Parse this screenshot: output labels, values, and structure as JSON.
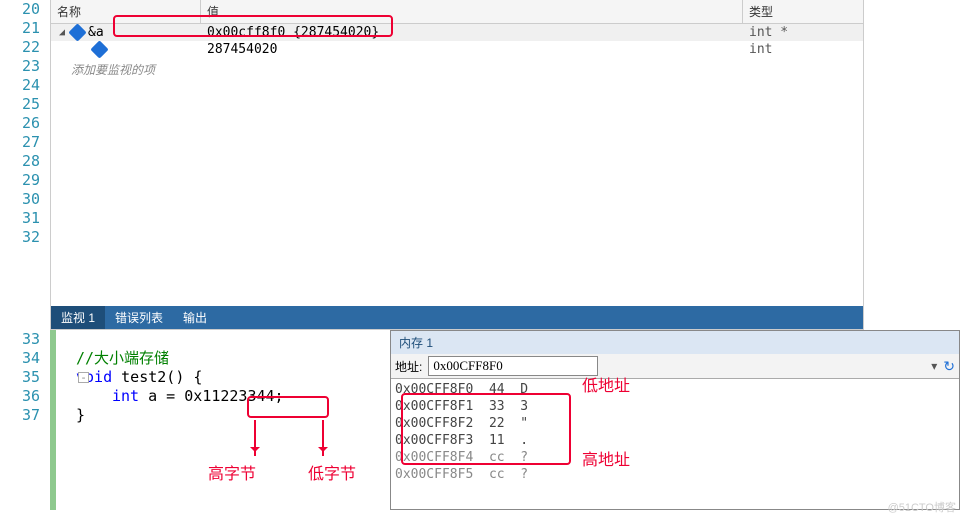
{
  "line_numbers": [
    "20",
    "21",
    "22",
    "23",
    "24",
    "25",
    "26",
    "27",
    "28",
    "29",
    "30",
    "31",
    "32",
    "33",
    "34",
    "35",
    "36",
    "37"
  ],
  "watch": {
    "headers": {
      "name": "名称",
      "value": "值",
      "type": "类型"
    },
    "rows": [
      {
        "exp": "&a",
        "val": "0x00cff8f0 {287454020}",
        "type": "int *"
      },
      {
        "exp": "",
        "val": "287454020",
        "type": "int"
      }
    ],
    "add_prompt": "添加要监视的项",
    "tabs": {
      "watch1": "监视 1",
      "errors": "错误列表",
      "output": "输出"
    }
  },
  "code": {
    "comment": "//大小端存储",
    "decl_kw": "void",
    "decl_fn": "test2()",
    "decl_brace": " {",
    "var_kw": "int",
    "var_rest": " a = 0x",
    "var_lit": "11223344;",
    "close": "}"
  },
  "annot": {
    "high_byte": "高字节",
    "low_byte": "低字节",
    "low_addr": "低地址",
    "high_addr": "高地址"
  },
  "memory": {
    "title": "内存 1",
    "addr_label": "地址:",
    "addr_value": "0x00CFF8F0",
    "rows": [
      {
        "a": "0x00CFF8F0",
        "b": "44",
        "c": "D"
      },
      {
        "a": "0x00CFF8F1",
        "b": "33",
        "c": "3"
      },
      {
        "a": "0x00CFF8F2",
        "b": "22",
        "c": "\""
      },
      {
        "a": "0x00CFF8F3",
        "b": "11",
        "c": "."
      },
      {
        "a": "0x00CFF8F4",
        "b": "cc",
        "c": "?"
      },
      {
        "a": "0x00CFF8F5",
        "b": "cc",
        "c": "?"
      }
    ]
  },
  "watermark": "@51CTO博客"
}
